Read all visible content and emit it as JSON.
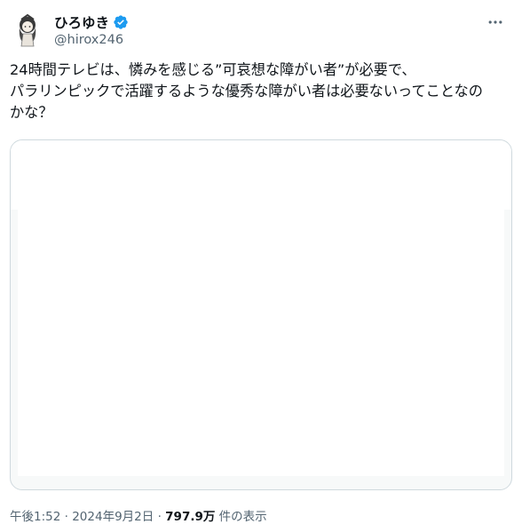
{
  "author": {
    "display_name": "ひろゆき",
    "handle": "@hirox246",
    "verified": true,
    "badge_color": "#1d9bf0"
  },
  "tweet": {
    "lines": [
      "24時間テレビは、憐みを感じる”可哀想な障がい者”が必要で、",
      "パラリンピックで活躍するような優秀な障がい者は必要ないってことなの",
      "かな？"
    ]
  },
  "meta": {
    "time": "午後1:52",
    "separator": "·",
    "date": "2024年9月2日",
    "views_count": "797.9万",
    "views_label": "件の表示"
  },
  "icons": {
    "more": "more-dots-icon",
    "verified": "verified-badge-icon"
  }
}
